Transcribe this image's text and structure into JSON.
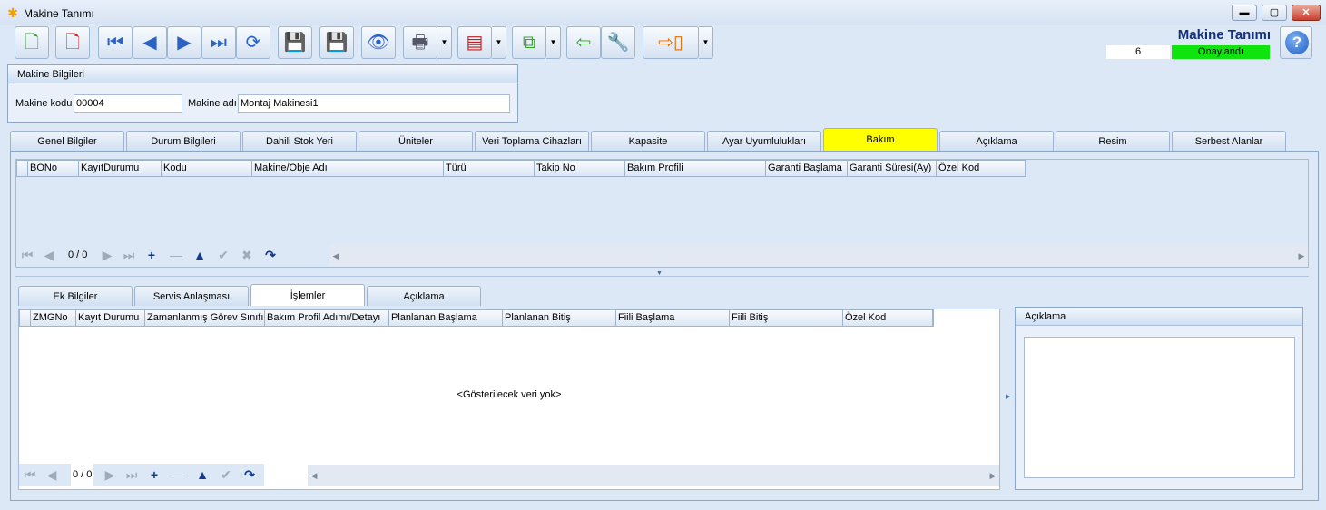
{
  "window": {
    "title": "Makine Tanımı",
    "min_label": "▬",
    "max_label": "▢",
    "close_label": "✕"
  },
  "icons": {
    "new_icon": "new-document-icon",
    "delete_icon": "delete-document-icon",
    "first_icon": "first-record-icon",
    "prev_icon": "previous-record-icon",
    "next_icon": "next-record-icon",
    "last_icon": "last-record-icon",
    "refresh_icon": "refresh-icon",
    "save_icon": "save-icon",
    "save_cancel_icon": "cancel-save-icon",
    "preview_icon": "preview-icon",
    "print_icon": "print-icon",
    "pdf_icon": "pdf-export-icon",
    "copy_icon": "copy-icon",
    "import_icon": "import-icon",
    "tools_icon": "tools-icon",
    "exit_icon": "exit-door-icon",
    "help_icon": "help-icon"
  },
  "header": {
    "form_title": "Makine Tanımı",
    "record_count": "6",
    "status": "Onaylandı",
    "status_color": "#0fe40f",
    "help_glyph": "?"
  },
  "machine_info": {
    "group_title": "Makine Bilgileri",
    "code_label": "Makine kodu",
    "code_value": "00004",
    "name_label": "Makine adı",
    "name_value": "Montaj Makinesi1"
  },
  "main_tabs": [
    {
      "label": "Genel Bilgiler"
    },
    {
      "label": "Durum Bilgileri"
    },
    {
      "label": "Dahili Stok Yeri"
    },
    {
      "label": "Üniteler"
    },
    {
      "label": "Veri Toplama Cihazları"
    },
    {
      "label": "Kapasite"
    },
    {
      "label": "Ayar Uyumlulukları"
    },
    {
      "label": "Bakım"
    },
    {
      "label": "Açıklama"
    },
    {
      "label": "Resim"
    },
    {
      "label": "Serbest Alanlar"
    }
  ],
  "active_tab_color": "#ffff00",
  "grid1": {
    "columns": [
      "BONo",
      "KayıtDurumu",
      "Kodu",
      "Makine/Obje Adı",
      "Türü",
      "Takip No",
      "Bakım Profili",
      "Garanti Başlama",
      "Garanti Süresi(Ay)",
      "Özel Kod"
    ],
    "counter": "0 / 0"
  },
  "sub_tabs": [
    {
      "label": "Ek Bilgiler"
    },
    {
      "label": "Servis Anlaşması"
    },
    {
      "label": "İşlemler"
    },
    {
      "label": "Açıklama"
    }
  ],
  "grid2": {
    "columns": [
      "ZMGNo",
      "Kayıt Durumu",
      "Zamanlanmış Görev Sınıfı",
      "Bakım Profil Adımı/Detayı",
      "Planlanan Başlama",
      "Planlanan Bitiş",
      "Fiili Başlama",
      "Fiili Bitiş",
      "Özel Kod"
    ],
    "empty_message": "<Gösterilecek veri yok>",
    "counter": "0 / 0"
  },
  "side_panel": {
    "title": "Açıklama"
  }
}
